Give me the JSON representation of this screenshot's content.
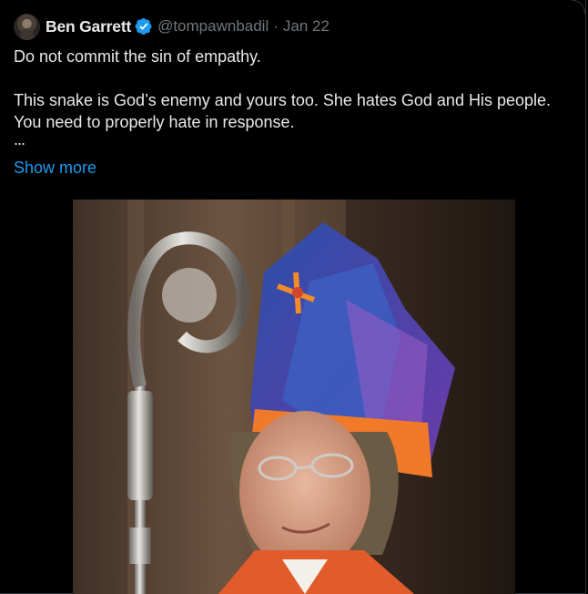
{
  "author": {
    "display_name": "Ben Garrett",
    "handle": "@tompawnbadil",
    "date": "Jan 22",
    "separator": "·",
    "verified": true,
    "avatar_icon": "user-avatar"
  },
  "tweet": {
    "lines": [
      "Do not commit the sin of empathy.",
      "This snake is God’s enemy and yours too. She hates God and His people. You need to properly hate in response."
    ],
    "ellipsis": "...",
    "show_more_label": "Show more"
  },
  "media": {
    "kind": "photo",
    "subject": "photo-of-bishop-with-crozier"
  },
  "colors": {
    "background": "#000000",
    "text": "#e7e9ea",
    "muted": "#71767b",
    "link": "#1d9bf0",
    "verified_badge": "#1d9bf0"
  }
}
